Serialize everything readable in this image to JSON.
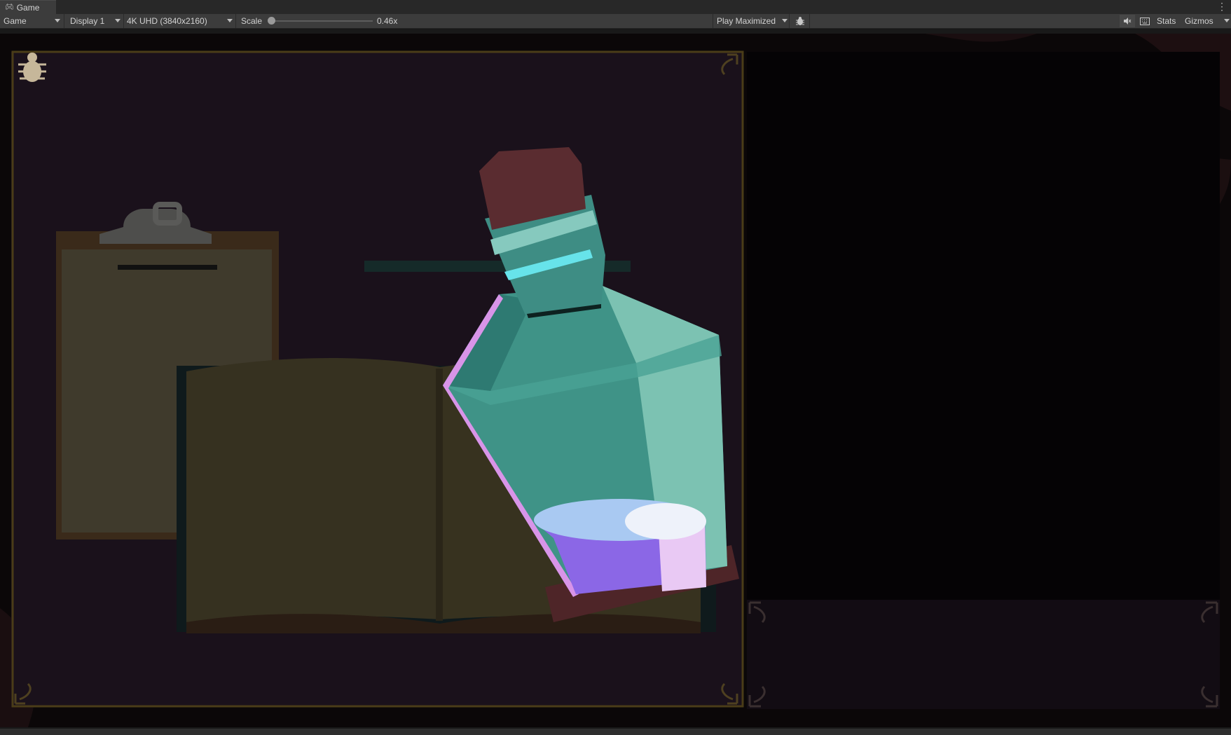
{
  "window": {
    "tab_label": "Game",
    "tab_icon": "gamepad-icon",
    "menu_glyph": "⋮"
  },
  "toolbar": {
    "mode_label": "Game",
    "display_label": "Display 1",
    "resolution_label": "4K UHD (3840x2160)",
    "scale_label": "Scale",
    "scale_value": "0.46x",
    "play_label": "Play Maximized",
    "stats_label": "Stats",
    "gizmos_label": "Gizmos"
  },
  "scene": {
    "background": "#0c0809",
    "panel_fill": "#1a111b",
    "frame_gold": "#4a3c18",
    "glass_teal": "#3f9387",
    "cork": "#5a2c30",
    "potion_purple": "#8b67e6"
  }
}
